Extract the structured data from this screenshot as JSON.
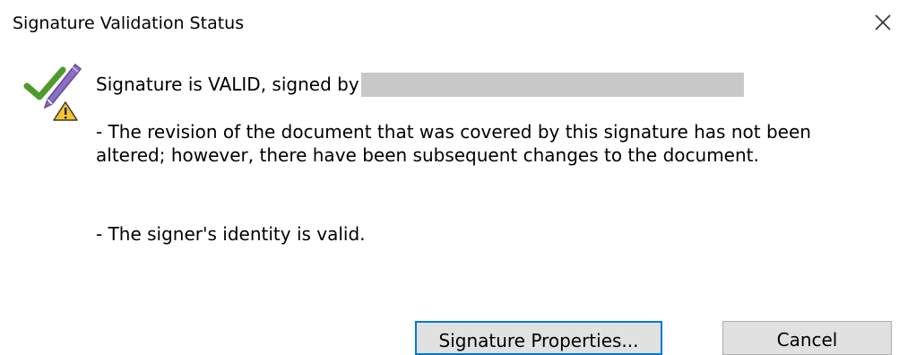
{
  "dialog": {
    "title": "Signature Validation Status",
    "close_icon": "close-icon"
  },
  "status": {
    "icon": "signature-valid-warning-icon",
    "prefix": "Signature is VALID, signed by",
    "signer_redacted": true
  },
  "details": {
    "line1": "- The revision of the document that was covered by this signature has not been altered; however, there have been subsequent changes to the document.",
    "line2": "- The signer's identity is valid."
  },
  "buttons": {
    "properties_label": "Signature Properties...",
    "cancel_label": "Cancel"
  },
  "colors": {
    "check_green": "#4f9a2c",
    "pen_purple": "#8b6fc4",
    "warning_yellow": "#f4c430",
    "focus_blue": "#0078d7",
    "button_bg": "#e1e1e1",
    "redaction_gray": "#c8c8c8"
  }
}
